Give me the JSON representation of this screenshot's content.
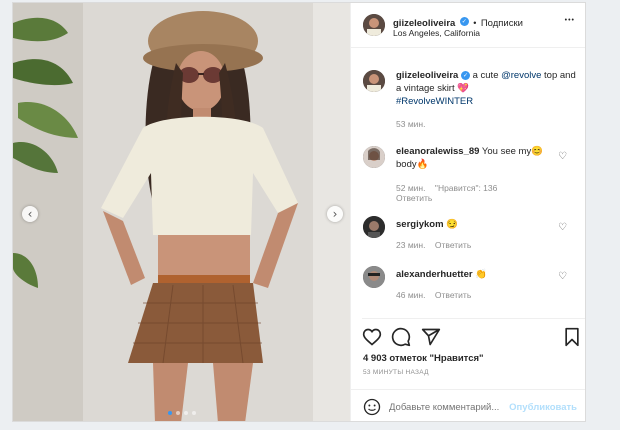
{
  "post": {
    "username": "giizeleoliveira",
    "dot_separator": "•",
    "follow_label": "Подписки",
    "location": "Los Angeles, California",
    "more_glyph": "•••"
  },
  "caption": {
    "username": "giizeleoliveira",
    "text_1": " a cute ",
    "mention": "@revolve",
    "text_2": " top and a vintage skirt ",
    "emoji": "💖",
    "hashtag": "#RevolveWINTER",
    "time": "53 мин."
  },
  "comments": [
    {
      "username": "eleanoralewiss_89",
      "text": " You see my",
      "emoji_1": "😊",
      "text_2": " body",
      "emoji_2": "🔥",
      "time": "52 мин.",
      "likes": "\"Нравится\": 136",
      "reply": "Ответить"
    },
    {
      "username": "sergiykom",
      "emoji": "😏",
      "time": "23 мин.",
      "reply": "Ответить"
    },
    {
      "username": "alexanderhuetter",
      "emoji": "👏",
      "time": "46 мин.",
      "reply": "Ответить"
    }
  ],
  "likes_text": "4 903 отметок \"Нравится\"",
  "timestamp": "53 минуты назад",
  "comment_placeholder": "Добавьте комментарий...",
  "publish_label": "Опубликовать",
  "carousel": {
    "total": 4,
    "active": 0,
    "prev_glyph": "‹",
    "next_glyph": "›"
  },
  "colors": {
    "accent": "#3897f0",
    "publish_disabled": "#b2dffc",
    "hashtag": "#00376b"
  },
  "icons": [
    "heart-icon",
    "comment-icon",
    "share-icon",
    "bookmark-icon",
    "emoji-icon",
    "verified-icon",
    "more-icon"
  ]
}
